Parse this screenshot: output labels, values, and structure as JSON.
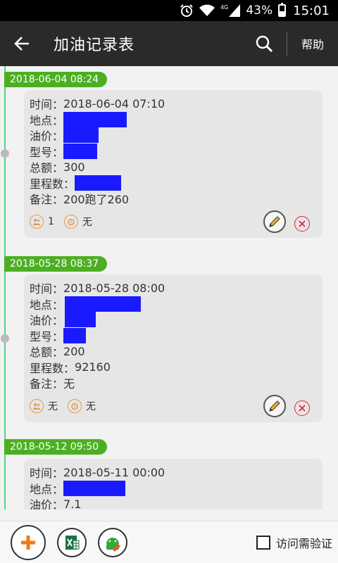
{
  "status_bar": {
    "network": "4G",
    "battery": "43%",
    "battery_level": 0.43,
    "time": "15:01"
  },
  "app_bar": {
    "title": "加油记录表",
    "help_label": "帮助"
  },
  "records": [
    {
      "date": "2018-06-04 08:24",
      "fields": [
        {
          "label": "时间：",
          "value": "2018-06-04 07:10"
        },
        {
          "label": "地点：",
          "value": "",
          "redacted": true
        },
        {
          "label": "油价：",
          "value": "",
          "redacted": true
        },
        {
          "label": "型号：",
          "value": "",
          "redacted": true
        },
        {
          "label": "总额：",
          "value": "300"
        },
        {
          "label": "里程数：",
          "value": "",
          "redacted": true
        },
        {
          "label": "备注：",
          "value": "200跑了260"
        }
      ],
      "meta1": "1",
      "meta2": "无"
    },
    {
      "date": "2018-05-28 08:37",
      "fields": [
        {
          "label": "时间：",
          "value": "2018-05-28 08:00"
        },
        {
          "label": "地点：",
          "value": "",
          "redacted": true
        },
        {
          "label": "油价：",
          "value": "",
          "redacted": true
        },
        {
          "label": "型号：",
          "value": "",
          "redacted": true
        },
        {
          "label": "总额：",
          "value": "200"
        },
        {
          "label": "里程数：",
          "value": "92160"
        },
        {
          "label": "备注：",
          "value": "无"
        }
      ],
      "meta1": "无",
      "meta2": "无"
    },
    {
      "date": "2018-05-12 09:50",
      "fields": [
        {
          "label": "时间：",
          "value": "2018-05-11 00:00"
        },
        {
          "label": "地点：",
          "value": "",
          "redacted": true
        },
        {
          "label": "油价：",
          "value": "7.1"
        }
      ]
    }
  ],
  "bottom_bar": {
    "verify_label": "访问需验证",
    "verify_checked": false
  },
  "colors": {
    "accent_green": "#4caf23",
    "redaction_blue": "#1a1aff",
    "delete_red": "#e2223f",
    "add_orange": "#f07a1a"
  }
}
